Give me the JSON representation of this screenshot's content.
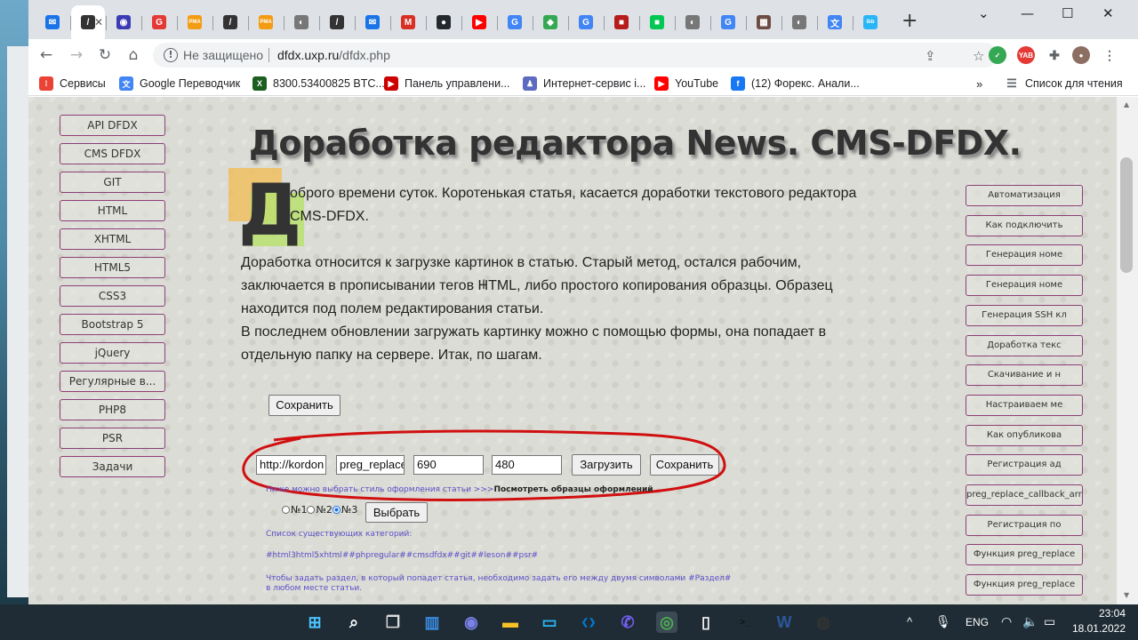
{
  "browser": {
    "tabs": [
      {
        "icon": "mail-icon",
        "color": "#1a73e8",
        "glyph": "✉"
      },
      {
        "icon": "slash-logo-icon",
        "color": "#333333",
        "glyph": "/",
        "active": true
      },
      {
        "icon": "circle-logo-icon",
        "color": "#3b3bb3",
        "glyph": "◉"
      },
      {
        "icon": "red-circle-icon",
        "color": "#e53935",
        "glyph": "G"
      },
      {
        "icon": "rma-icon",
        "color": "#f39c12",
        "glyph": "PMA"
      },
      {
        "icon": "slash-logo-icon",
        "color": "#333333",
        "glyph": "/"
      },
      {
        "icon": "rma-icon",
        "color": "#f39c12",
        "glyph": "PMA"
      },
      {
        "icon": "globe-icon",
        "color": "#777777",
        "glyph": "◐"
      },
      {
        "icon": "slash-logo-icon",
        "color": "#333333",
        "glyph": "/"
      },
      {
        "icon": "mail-icon",
        "color": "#1a73e8",
        "glyph": "✉"
      },
      {
        "icon": "gmail-icon",
        "color": "#d93025",
        "glyph": "M"
      },
      {
        "icon": "github-icon",
        "color": "#24292e",
        "glyph": "●"
      },
      {
        "icon": "youtube-icon",
        "color": "#ff0000",
        "glyph": "▶"
      },
      {
        "icon": "google-icon",
        "color": "#4285f4",
        "glyph": "G"
      },
      {
        "icon": "green-puzzle-icon",
        "color": "#34a853",
        "glyph": "◆"
      },
      {
        "icon": "google-icon",
        "color": "#4285f4",
        "glyph": "G"
      },
      {
        "icon": "book-icon",
        "color": "#b71c1c",
        "glyph": "■"
      },
      {
        "icon": "green-square-icon",
        "color": "#00c853",
        "glyph": "■"
      },
      {
        "icon": "globe-icon",
        "color": "#777777",
        "glyph": "◐"
      },
      {
        "icon": "google-icon",
        "color": "#4285f4",
        "glyph": "G"
      },
      {
        "icon": "picture-icon",
        "color": "#6d4c41",
        "glyph": "▦"
      },
      {
        "icon": "globe-icon",
        "color": "#777777",
        "glyph": "◐"
      },
      {
        "icon": "translate-icon",
        "color": "#4285f4",
        "glyph": "文"
      },
      {
        "icon": "ibb-icon",
        "color": "#29b6f6",
        "glyph": "ibb"
      }
    ],
    "new_tab": "+",
    "window_controls": [
      "⌄",
      "—",
      "☐",
      "✕"
    ],
    "insecure_label": "Не защищено",
    "url_host": "dfdx.uxp.ru",
    "url_path": "/dfdx.php",
    "bookmarks": [
      {
        "label": "Сервисы",
        "icon": "apps-icon",
        "color": "#ea4335",
        "glyph": "⁞"
      },
      {
        "label": "Google Переводчик",
        "icon": "translate-icon",
        "color": "#4285f4",
        "glyph": "文"
      },
      {
        "label": "8300.53400825 BTC...",
        "icon": "x-logo-icon",
        "color": "#1b5e20",
        "glyph": "X"
      },
      {
        "label": "Панель управлени...",
        "icon": "youtube-icon",
        "color": "#cc0000",
        "glyph": "▶"
      },
      {
        "label": "Интернет-сервис i...",
        "icon": "person-icon",
        "color": "#5c6bc0",
        "glyph": "♟"
      },
      {
        "label": "YouTube",
        "icon": "youtube-icon",
        "color": "#ff0000",
        "glyph": "▶"
      },
      {
        "label": "(12) Форекс. Анали...",
        "icon": "facebook-icon",
        "color": "#1877f2",
        "glyph": "f"
      }
    ],
    "more_bookmarks": "»",
    "reading_list": "Список для чтения"
  },
  "page": {
    "title": "Доработка редактора News. CMS-DFDX.",
    "dropcap": "Д",
    "intro_line1": "оброго времени суток. Коротенькая статья, касается доработки текстового редактора",
    "intro_line2": "CMS-DFDX.",
    "para2": [
      "Доработка относится к загрузке картинок в статью. Старый метод, остался рабочим,",
      "заключается в прописывании тегов HTML, либо простого копирования образцы. Образец",
      "находится под полем редактирования статьи.",
      "В последнем обновлении загружать картинку можно с помощью формы, она попадает в",
      "отдельную папку на сервере. Итак, по шагам."
    ],
    "left_nav": [
      "API DFDX",
      "CMS DFDX",
      "GIT",
      "HTML",
      "XHTML",
      "HTML5",
      "CSS3",
      "Bootstrap 5",
      "jQuery",
      "Регулярные в...",
      "PHP8",
      "PSR",
      "Задачи"
    ],
    "right_nav": [
      "Автоматизация",
      "Как подключить",
      "Генерация номе",
      "Генерация номе",
      "Генерация SSH кл",
      "Доработка текс",
      "Скачивание и н",
      "Настраиваем ме",
      "Как опубликова",
      "Регистрация ад",
      "preg_replace_callback_array",
      "Регистрация по",
      "Функция preg_replace",
      "Функция preg_replace"
    ],
    "save_top": "Сохранить",
    "form": {
      "field1": "http://kordon",
      "field2": "preg_replace(",
      "width": "690",
      "height": "480",
      "upload": "Загрузить",
      "save": "Сохранить"
    },
    "style_hint": "Ниже можно выбрать стиль оформления статьи >>>",
    "style_link": "Посмотреть образцы оформлений",
    "radios": [
      "№1",
      "№2",
      "№3"
    ],
    "choose": "Выбрать",
    "categories_label": "Список существующих категорий:",
    "categories": "#html3html5xhtml##phpregular##cmsdfdx##git##leson##psr#",
    "section_hint1": "Чтобы задать раздел, в который попадет статья, необходимо задать его между двумя символами #Раздел#",
    "section_hint2": "в любом месте статьи."
  },
  "taskbar": {
    "icons": [
      {
        "name": "windows-start-icon",
        "color": "#4cc2ff",
        "glyph": "⊞"
      },
      {
        "name": "search-icon",
        "color": "#ffffff",
        "glyph": "⌕"
      },
      {
        "name": "task-view-icon",
        "color": "#dddddd",
        "glyph": "❐"
      },
      {
        "name": "widgets-icon",
        "color": "#3a8ee6",
        "glyph": "▥"
      },
      {
        "name": "teams-chat-icon",
        "color": "#7b83eb",
        "glyph": "◉"
      },
      {
        "name": "file-explorer-icon",
        "color": "#f6c026",
        "glyph": "▬"
      },
      {
        "name": "monitor-icon",
        "color": "#29b6f6",
        "glyph": "▭"
      },
      {
        "name": "vscode-icon",
        "color": "#007acc",
        "glyph": "❮❯"
      },
      {
        "name": "viber-icon",
        "color": "#7360f2",
        "glyph": "✆"
      },
      {
        "name": "chrome-icon",
        "color": "#4caf50",
        "glyph": "◎"
      },
      {
        "name": "notepad-icon",
        "color": "#f5f5f5",
        "glyph": "▯"
      },
      {
        "name": "terminal-icon",
        "color": "#111111",
        "glyph": ">_"
      },
      {
        "name": "word-icon",
        "color": "#2b579a",
        "glyph": "W"
      },
      {
        "name": "obs-icon",
        "color": "#333333",
        "glyph": "◍"
      }
    ],
    "lang": "ENG",
    "time": "23:04",
    "date": "18.01.2022"
  }
}
